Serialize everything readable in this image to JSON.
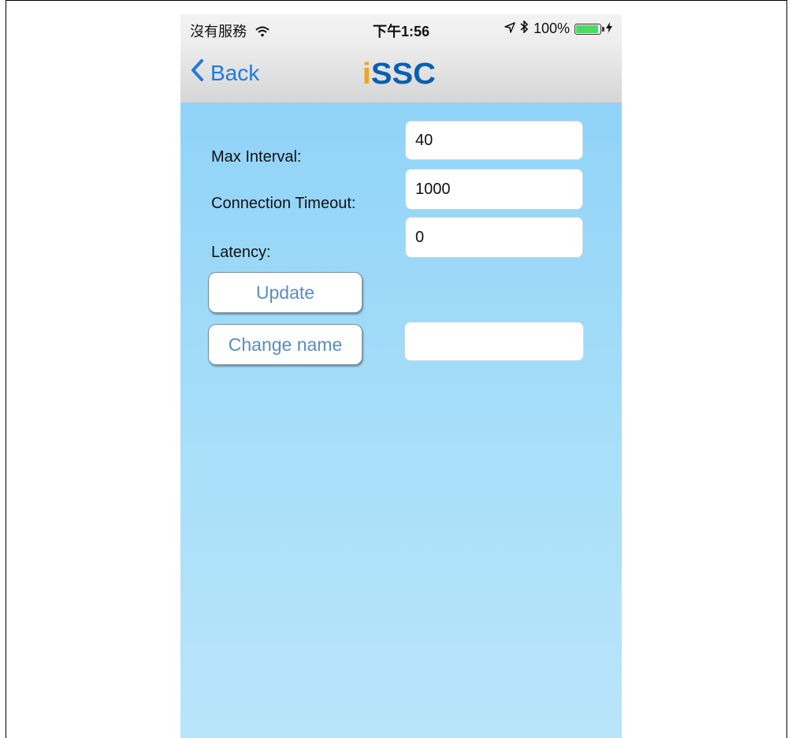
{
  "status_bar": {
    "carrier": "沒有服務",
    "wifi_icon": "wifi-icon",
    "time": "下午1:56",
    "location_icon": "location-arrow-icon",
    "bluetooth_icon": "bluetooth-icon",
    "battery_percent": "100%",
    "battery_level": 1.0,
    "charging_icon": "bolt-icon"
  },
  "nav": {
    "back_label": "Back",
    "back_icon": "chevron-left-icon",
    "logo_text_part1": "i",
    "logo_text_part2": "SSC",
    "accent_color": "#1f7ae0",
    "logo_color": "#0a5fae",
    "logo_dot_color": "#f2a21c"
  },
  "form": {
    "max_interval_label": "Max Interval:",
    "max_interval_value": "40",
    "connection_timeout_label": "Connection Timeout:",
    "connection_timeout_value": "1000",
    "latency_label": "Latency:",
    "latency_value": "0",
    "update_button": "Update",
    "change_name_button": "Change name",
    "name_value": ""
  }
}
